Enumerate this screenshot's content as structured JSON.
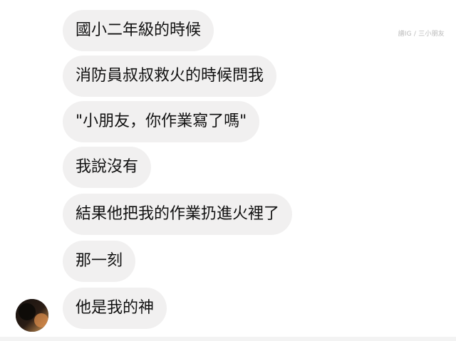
{
  "watermark": "譜IG / 三小朋友",
  "messages": [
    {
      "text": "國小二年級的時候"
    },
    {
      "text": "消防員叔叔救火的時候問我"
    },
    {
      "text": "\"小朋友，你作業寫了嗎\""
    },
    {
      "text": "我說沒有"
    },
    {
      "text": "結果他把我的作業扔進火裡了"
    },
    {
      "text": "那一刻"
    },
    {
      "text": "他是我的神"
    }
  ],
  "colors": {
    "bubble_bg": "#f1f0f0",
    "text": "#111111",
    "page_bg": "#ffffff"
  },
  "icons": {
    "avatar": "user-avatar-icon"
  }
}
